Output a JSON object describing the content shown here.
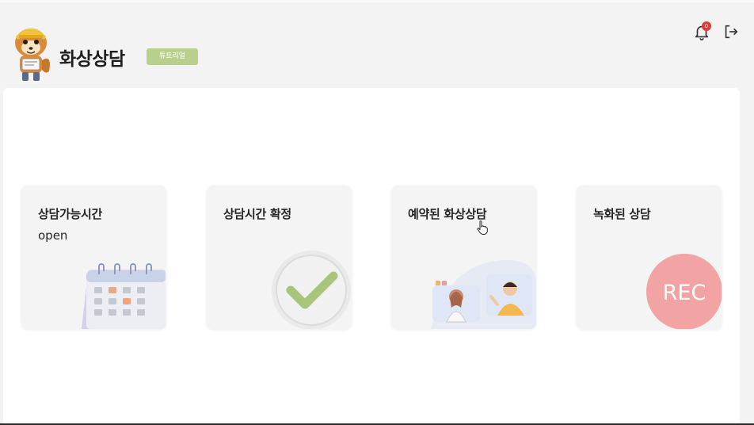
{
  "header": {
    "title": "화상상담",
    "badge": "튜토리얼",
    "notification_count": "0",
    "icons": [
      "mascot-icon",
      "bell-icon",
      "logout-icon"
    ]
  },
  "cards": [
    {
      "title": "상담가능시간",
      "subtitle": "open",
      "icon": "calendar-icon"
    },
    {
      "title": "상담시간 확정",
      "icon": "checkmark-icon"
    },
    {
      "title": "예약된 화상상담",
      "icon": "video-call-icon"
    },
    {
      "title": "녹화된 상담",
      "icon": "rec-icon",
      "icon_text": "REC"
    }
  ],
  "colors": {
    "background": "#f3f3f3",
    "badge": "#b9d08d",
    "notification": "#e53935",
    "rec": "#f2a3a3",
    "check": "#a8c57c"
  }
}
